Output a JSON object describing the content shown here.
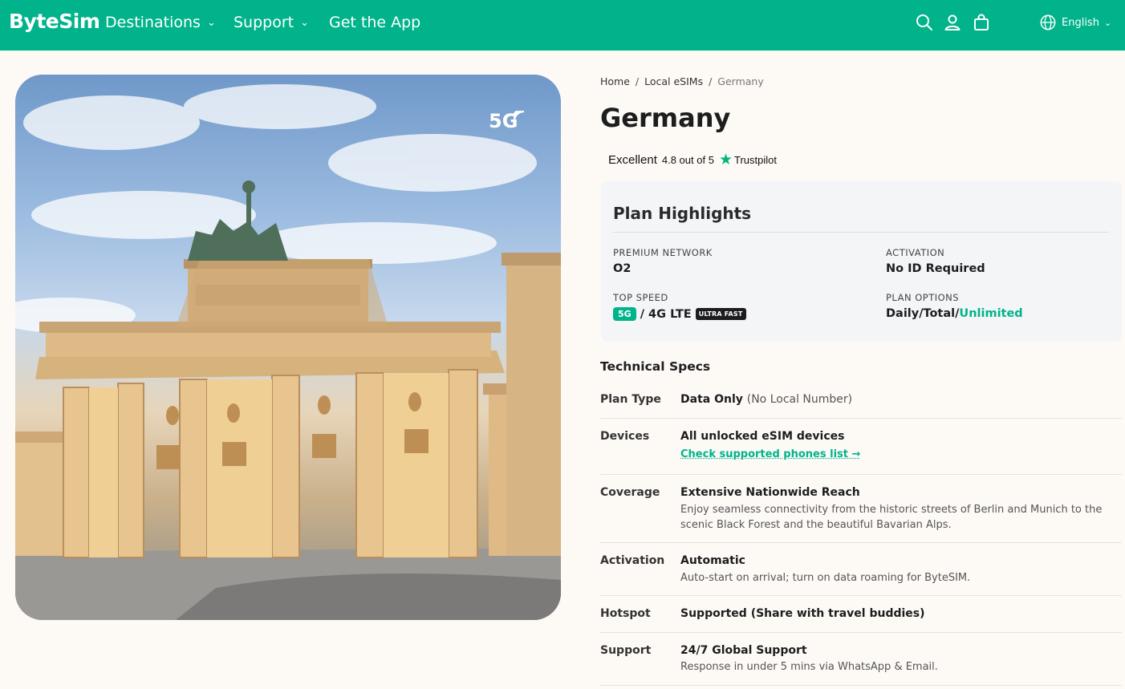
{
  "header": {
    "logo": "ByteSim",
    "nav": [
      {
        "label": "Destinations",
        "has_dropdown": true
      },
      {
        "label": "Support",
        "has_dropdown": true
      },
      {
        "label": "Get the App",
        "has_dropdown": false
      }
    ],
    "icons": [
      "search-icon",
      "user-icon",
      "cart-icon"
    ],
    "language": "English",
    "bg_color": "#00b38b"
  },
  "hero": {
    "badge": "5G",
    "image_subject": "Brandenburg Gate"
  },
  "breadcrumb": {
    "home": "Home",
    "local": "Local eSIMs",
    "current": "Germany",
    "separator": "/"
  },
  "page_title": "Germany",
  "rating": {
    "label": "Excellent",
    "score": "4.8 out of 5",
    "provider": "Trustpilot"
  },
  "highlights": {
    "title": "Plan Highlights",
    "network_label": "PREMIUM NETWORK",
    "network_value": "O2",
    "activation_label": "ACTIVATION",
    "activation_value": "No ID Required",
    "speed_label": "TOP SPEED",
    "speed_badge": "5G",
    "speed_value": "/ 4G LTE",
    "speed_tag": "ULTRA FAST",
    "options_label": "PLAN OPTIONS",
    "options_value": "Daily/Total/",
    "options_highlight": "Unlimited"
  },
  "specs": {
    "title": "Technical Specs",
    "plan_type_label": "Plan Type",
    "plan_type_value": "Data Only",
    "plan_type_note": "(No Local Number)",
    "devices_label": "Devices",
    "devices_value": "All unlocked eSIM devices",
    "devices_link": "Check supported phones list →",
    "coverage_label": "Coverage",
    "coverage_value": "Extensive Nationwide Reach",
    "coverage_desc_1": "Enjoy seamless connectivity from the historic streets of Berlin and Munich to the",
    "coverage_desc_2": "scenic Black Forest and the beautiful Bavarian Alps.",
    "activation_label": "Activation",
    "activation_value": "Automatic",
    "activation_desc": "Auto-start on arrival; turn on data roaming for ByteSIM.",
    "hotspot_label": "Hotspot",
    "hotspot_value": "Supported (Share with travel buddies)",
    "support_label": "Support",
    "support_value": "24/7 Global Support",
    "support_desc": "Response in under 5 mins via WhatsApp & Email."
  }
}
